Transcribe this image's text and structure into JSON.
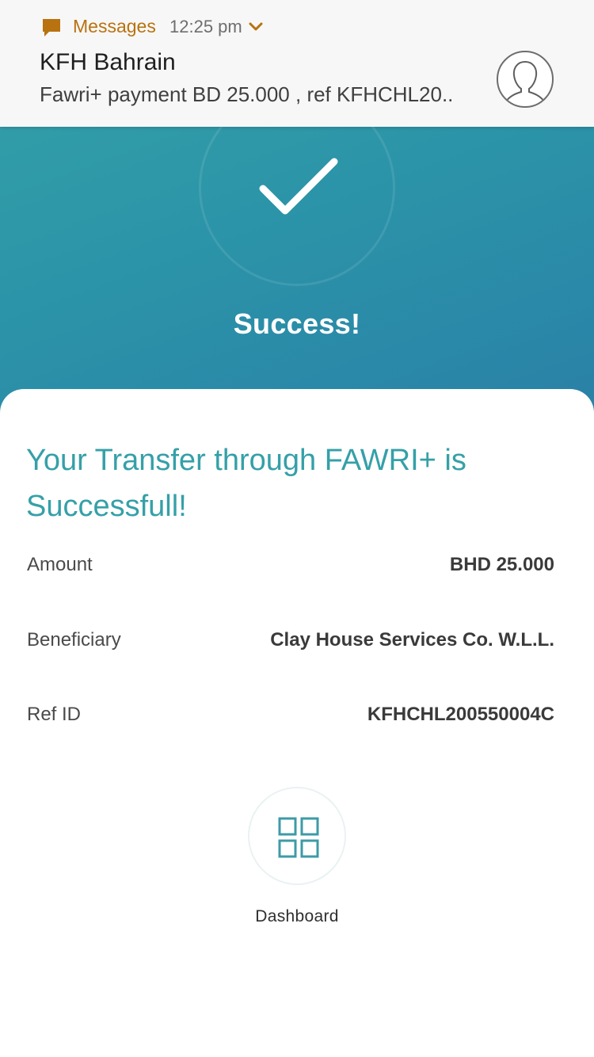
{
  "notification": {
    "app_name": "Messages",
    "time": "12:25 pm",
    "sender": "KFH Bahrain",
    "body": "Fawri+ payment BD 25.000 , ref KFHCHL20..",
    "app_icon": "chat-bubble-icon",
    "expand_icon": "chevron-down-icon",
    "avatar_icon": "person-silhouette-icon",
    "accent_color": "#b8720f"
  },
  "hero": {
    "title": "Success!",
    "icon": "checkmark-icon",
    "gradient_start": "#35a3a9",
    "gradient_end": "#2a7fa7"
  },
  "card": {
    "heading": "Your Transfer through FAWRI+ is Successfull!",
    "heading_color": "#35a0a8",
    "details": [
      {
        "label": "Amount",
        "value": "BHD 25.000"
      },
      {
        "label": "Beneficiary",
        "value": "Clay House Services Co. W.L.L."
      },
      {
        "label": "Ref ID",
        "value": "KFHCHL200550004C"
      }
    ]
  },
  "dashboard": {
    "label": "Dashboard",
    "icon": "grid-icon"
  }
}
